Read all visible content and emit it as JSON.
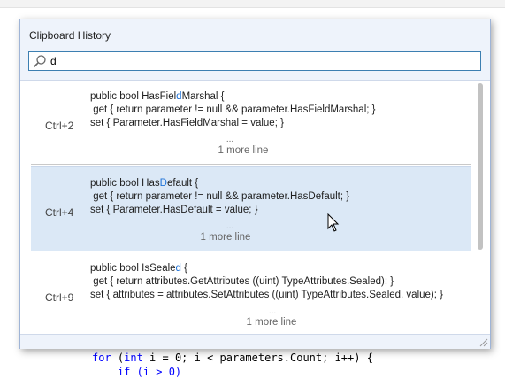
{
  "popup": {
    "title": "Clipboard History",
    "search": {
      "value": "d",
      "placeholder": ""
    }
  },
  "items": [
    {
      "shortcut": "Ctrl+2",
      "line1_pre": "public bool HasFiel",
      "line1_hl": "d",
      "line1_post": "Marshal {",
      "line2": " get { return parameter != null && parameter.HasFieldMarshal; }",
      "line3": "set { Parameter.HasFieldMarshal = value; }",
      "ellipsis": "...",
      "more": "1 more line"
    },
    {
      "shortcut": "Ctrl+4",
      "line1_pre": "public bool Has",
      "line1_hl": "D",
      "line1_post": "efault {",
      "line2": " get { return parameter != null && parameter.HasDefault; }",
      "line3": "set { Parameter.HasDefault = value; }",
      "ellipsis": "...",
      "more": "1 more line"
    },
    {
      "shortcut": "Ctrl+9",
      "line1_pre": "public bool IsSeale",
      "line1_hl": "d",
      "line1_post": " {",
      "line2": " get { return attributes.GetAttributes ((uint) TypeAttributes.Sealed); }",
      "line3": "set { attributes = attributes.SetAttributes ((uint) TypeAttributes.Sealed, value); }",
      "ellipsis": "...",
      "more": "1 more line"
    }
  ],
  "editor": {
    "line1_kw1": "for",
    "line1_mid1": " (",
    "line1_kw2": "int",
    "line1_rest": " i = 0; i < parameters.Count; i++) {",
    "line2": "    if (i > 0)"
  },
  "colors": {
    "accent": "#1f73d8",
    "selected_bg": "#dbe8f6",
    "header_bg": "#eef3fb"
  }
}
